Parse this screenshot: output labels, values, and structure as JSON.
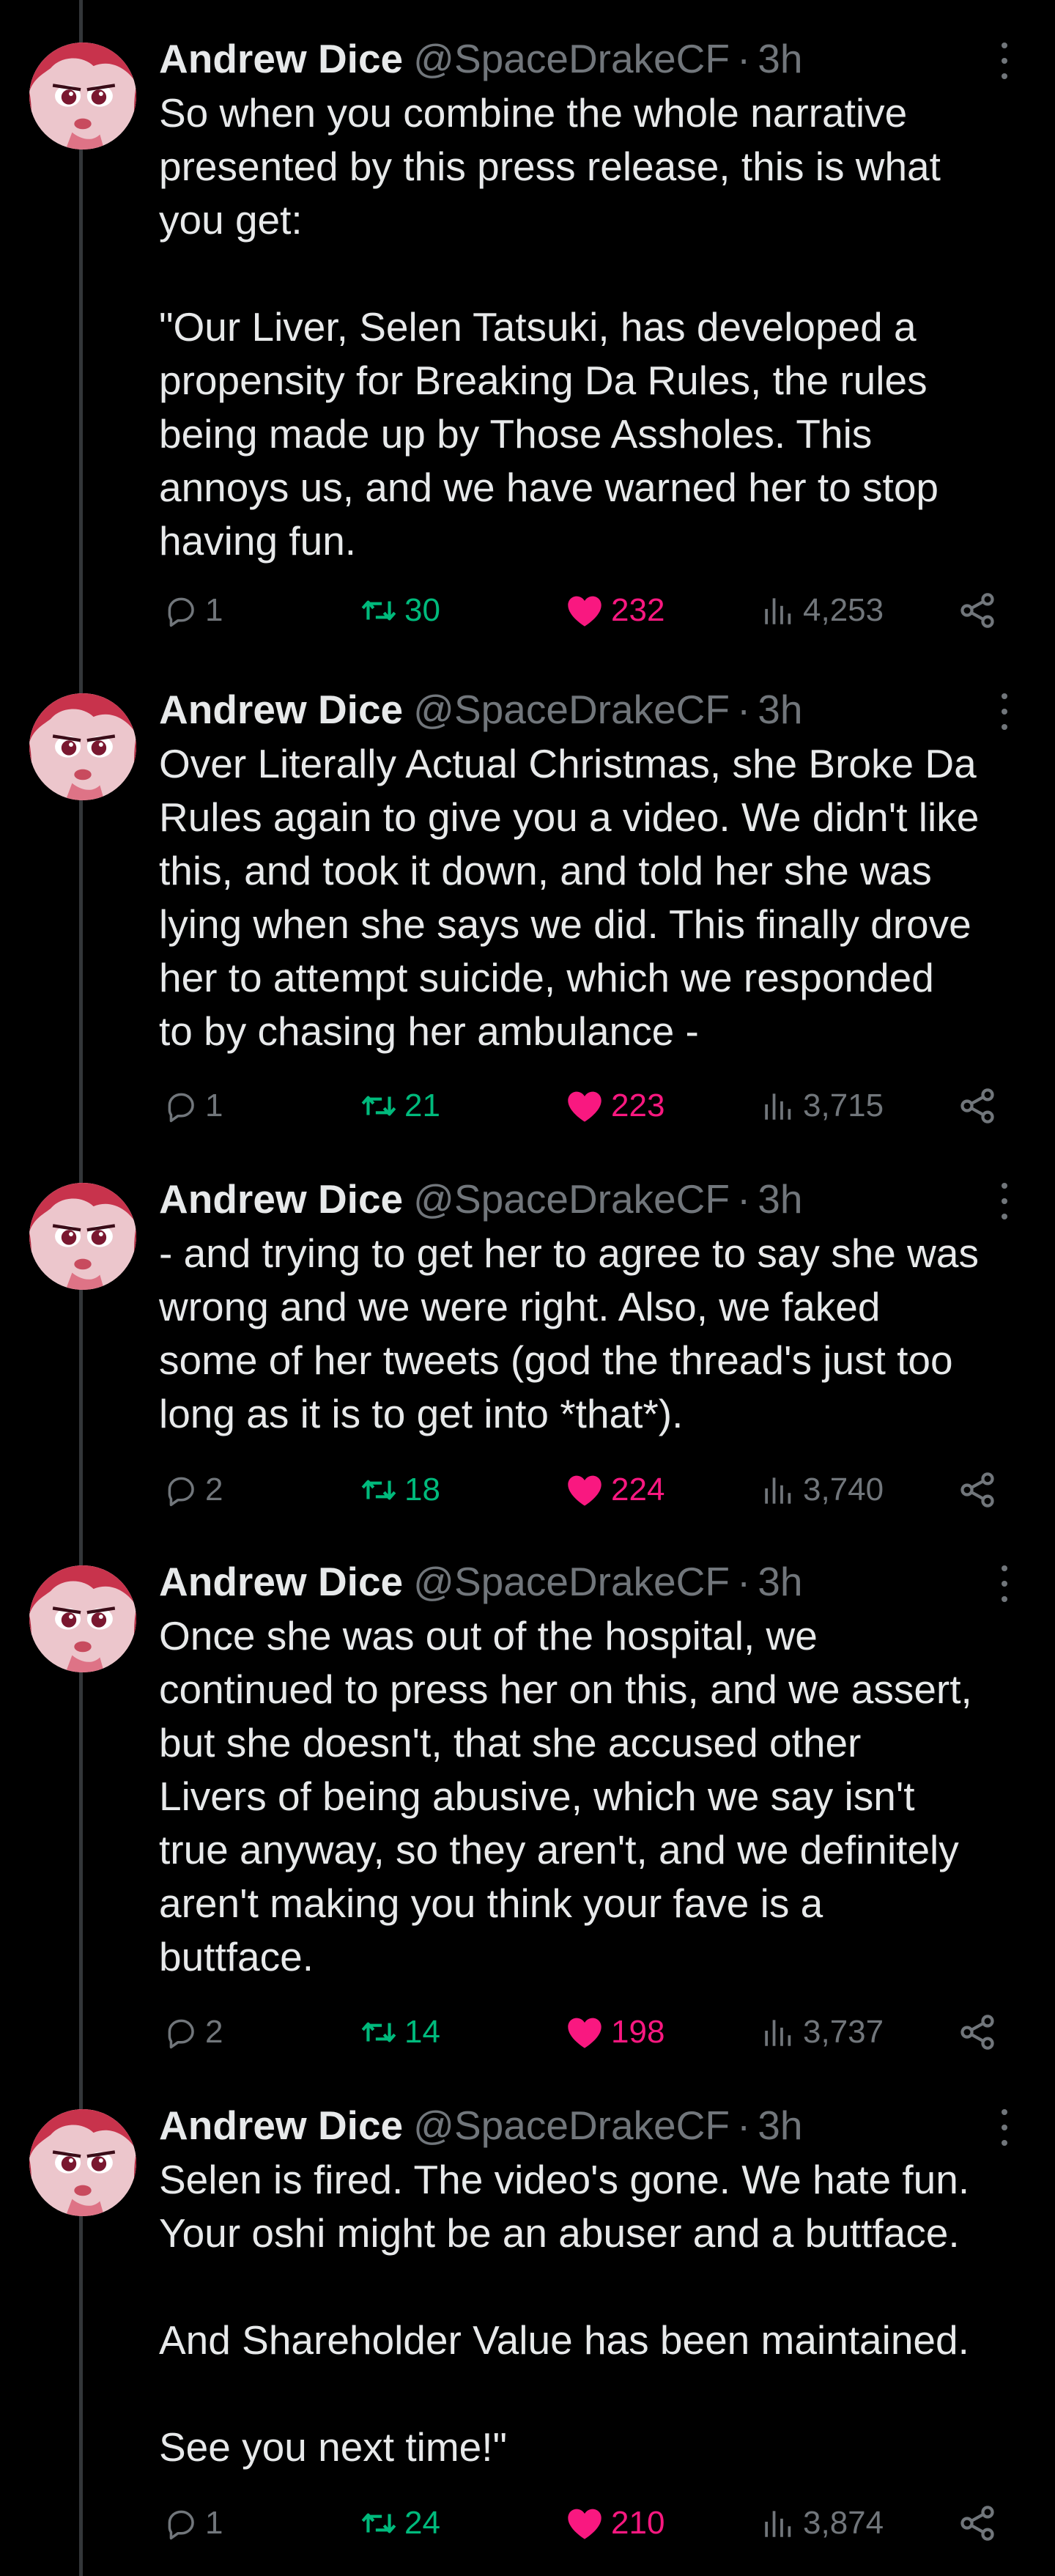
{
  "colors": {
    "background": "#000000",
    "text": "#e7e9ea",
    "muted": "#71767b",
    "retweet": "#00ba7c",
    "like": "#f91880",
    "thread_line": "#333639"
  },
  "icons": {
    "reply": "reply-bubble-icon",
    "retweet": "retweet-icon",
    "like": "heart-filled-icon",
    "views": "bar-chart-icon",
    "share": "share-icon",
    "more": "more-vertical-icon"
  },
  "tweets": [
    {
      "author": "Andrew Dice",
      "handle": "@SpaceDrakeCF",
      "separator": "·",
      "time": "3h",
      "text": "So when you combine the whole narrative\npresented by this press release, this is what\nyou get:\n\n\"Our Liver, Selen Tatsuki, has developed a\npropensity for Breaking Da Rules, the rules\nbeing made up by Those Assholes. This\nannoys us, and we have warned her to stop\nhaving fun.",
      "replies": "1",
      "retweets": "30",
      "likes": "232",
      "views": "4,253"
    },
    {
      "author": "Andrew Dice",
      "handle": "@SpaceDrakeCF",
      "separator": "·",
      "time": "3h",
      "text": "Over Literally Actual Christmas, she Broke Da\nRules again to give you a video. We didn't like\nthis, and took it down, and told her she was\nlying when she says we did. This finally drove\nher to attempt suicide, which we responded\nto by chasing her ambulance -",
      "replies": "1",
      "retweets": "21",
      "likes": "223",
      "views": "3,715"
    },
    {
      "author": "Andrew Dice",
      "handle": "@SpaceDrakeCF",
      "separator": "·",
      "time": "3h",
      "text": "- and trying to get her to agree to say she was\nwrong and we were right. Also, we faked\nsome of her tweets (god the thread's just too\nlong as it is to get into *that*).",
      "replies": "2",
      "retweets": "18",
      "likes": "224",
      "views": "3,740"
    },
    {
      "author": "Andrew Dice",
      "handle": "@SpaceDrakeCF",
      "separator": "·",
      "time": "3h",
      "text": "Once she was out of the hospital, we\ncontinued to press her on this, and we assert,\nbut she doesn't, that she accused other\nLivers of being abusive, which we say isn't\ntrue anyway, so they aren't, and we definitely\naren't making you think your fave is a\nbuttface.",
      "replies": "2",
      "retweets": "14",
      "likes": "198",
      "views": "3,737"
    },
    {
      "author": "Andrew Dice",
      "handle": "@SpaceDrakeCF",
      "separator": "·",
      "time": "3h",
      "text": "Selen is fired. The video's gone. We hate fun.\nYour oshi might be an abuser and a buttface.\n\nAnd Shareholder Value has been maintained.\n\nSee you next time!\"",
      "replies": "1",
      "retweets": "24",
      "likes": "210",
      "views": "3,874"
    }
  ]
}
